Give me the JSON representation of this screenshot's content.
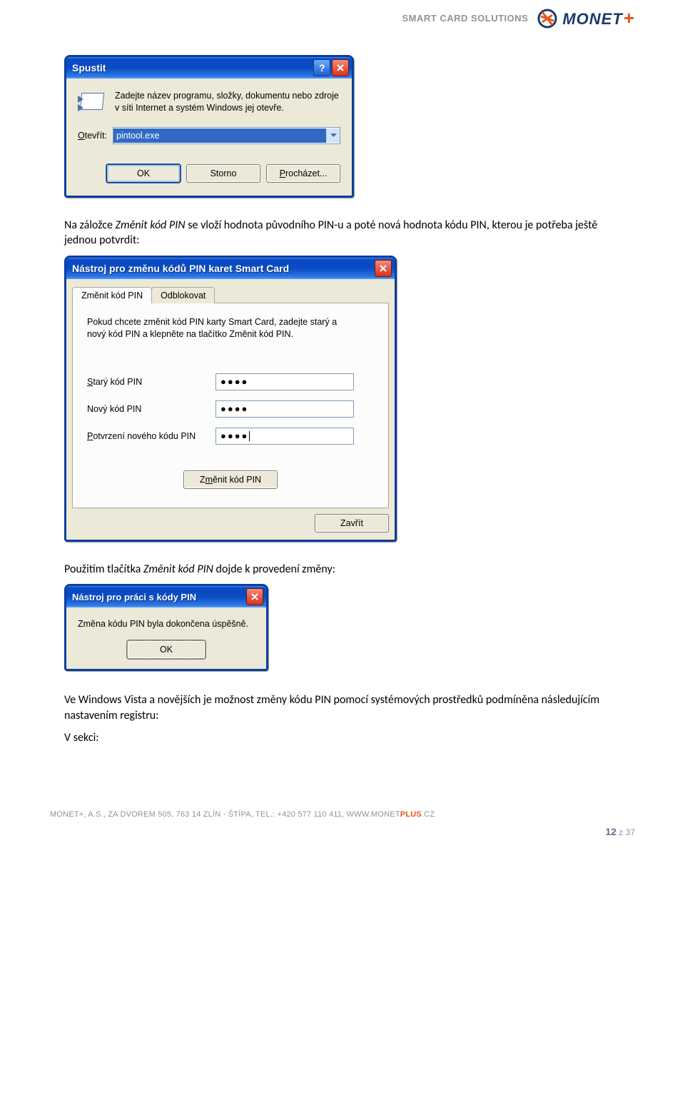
{
  "header": {
    "tagline": "SMART CARD SOLUTIONS",
    "brand": "MONET",
    "brand_plus": "+"
  },
  "run_dialog": {
    "title": "Spustit",
    "description": "Zadejte název programu, složky, dokumentu nebo zdroje v síti Internet a systém Windows jej otevře.",
    "open_label_pre": "O",
    "open_label_rest": "tevřít:",
    "value": "pintool.exe",
    "btn_ok": "OK",
    "btn_cancel": "Storno",
    "btn_browse_pre": "P",
    "btn_browse_rest": "rocházet..."
  },
  "body": {
    "para1_pre": "Na záložce ",
    "para1_em": "Změnit kód PIN",
    "para1_post": " se vloží hodnota původního PIN-u a poté nová hodnota kódu PIN, kterou je potřeba ještě jednou potvrdit:",
    "para2_pre": "Použitím tlačítka ",
    "para2_em": "Změnit kód PIN",
    "para2_post": " dojde k provedení změny:",
    "para3": "Ve Windows Vista a novějších je možnost změny kódu PIN pomocí systémových prostředků  podmíněna následujícím nastavením registru:",
    "para4": "V sekci:"
  },
  "pin_tool": {
    "title": "Nástroj pro změnu kódů PIN karet Smart Card",
    "tab_change": "Změnit kód PIN",
    "tab_unblock": "Odblokovat",
    "desc": "Pokud chcete změnit kód PIN karty Smart Card, zadejte starý a nový kód PIN a klepněte na tlačítko Změnit kód PIN.",
    "label_old_u": "S",
    "label_old_rest": "tarý kód PIN",
    "label_new": "Nový kód PIN",
    "label_conf_u": "P",
    "label_conf_rest": "otvrzení nového kódu PIN",
    "mask": "●●●●",
    "btn_change_pre": "Z",
    "btn_change_u": "m",
    "btn_change_post": "ěnit kód PIN",
    "btn_close": "Zavřít"
  },
  "msgbox": {
    "title": "Nástroj pro práci s kódy PIN",
    "text": "Změna kódu PIN byla dokončena úspěšně.",
    "btn_ok": "OK"
  },
  "footer": {
    "addr_pre": "MONET+, A.S., ZA DVOREM 505, 763 14 ZLÍN - ŠTÍPA, TEL.: +420 577 110 411, WWW.MONET",
    "addr_plus": "PLUS",
    "addr_post": ".CZ",
    "page_cur": "12",
    "page_sep": " z ",
    "page_total": "37"
  }
}
